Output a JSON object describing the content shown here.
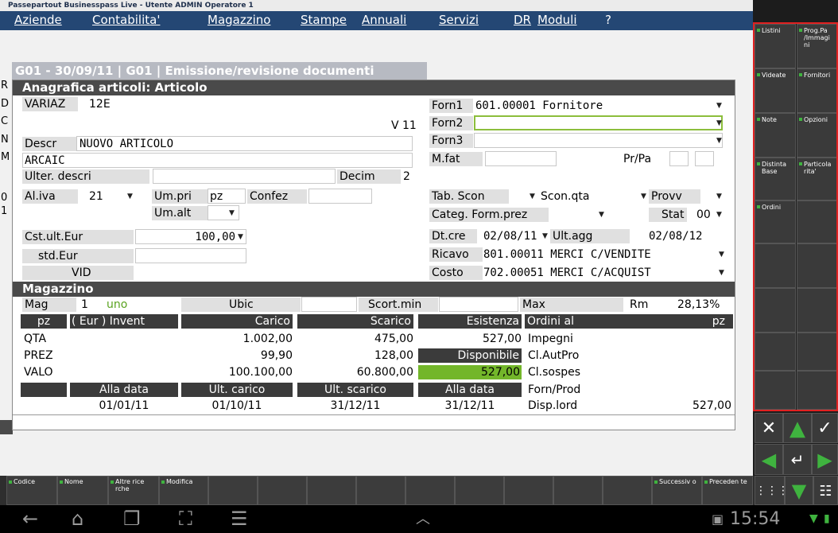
{
  "title": "Passepartout Businesspass Live - Utente ADMIN Operatore 1",
  "menu": [
    "Aziende",
    "Contabilita'",
    "Magazzino",
    "Stampe",
    "Annuali",
    "Servizi",
    "DR",
    "Moduli",
    "?"
  ],
  "doc_title": "G01 - 30/09/11 | G01  | Emissione/revisione documenti",
  "left_chars": [
    "R",
    "D",
    "C",
    "N",
    "M",
    "0",
    "1"
  ],
  "dialog_title": "Anagrafica articoli: Articolo",
  "art": {
    "variaz": "VARIAZ",
    "code": "12E",
    "version": "V 11",
    "descr_label": "Descr",
    "descr": "NUOVO ARTICOLO",
    "descr2": "ARCAIC",
    "ulter_label": "Ulter. descri",
    "decim_label": "Decim",
    "decim": "2",
    "aliva_label": "Al.iva",
    "aliva": "21",
    "umpri_label": "Um.pri",
    "umpri": "pz",
    "confez_label": "Confez",
    "umalt_label": "Um.alt",
    "cst_label": "Cst.ult.Eur",
    "cst": "100,00",
    "std_label": "std.Eur",
    "vid": "VID"
  },
  "right": {
    "forn1_label": "Forn1",
    "forn1": "601.00001 Fornitore",
    "forn2_label": "Forn2",
    "forn3_label": "Forn3",
    "mfat_label": "M.fat",
    "prpa_label": "Pr/Pa",
    "tabscon_label": "Tab. Scon",
    "sconqta_label": "Scon.qta",
    "provv_label": "Provv",
    "categ_label": "Categ. Form.prez",
    "stat_label": "Stat",
    "stat": "00",
    "dtcre_label": "Dt.cre",
    "dtcre": "02/08/11",
    "ultagg_label": "Ult.agg",
    "ultagg": "02/08/12",
    "ricavo_label": "Ricavo",
    "ricavo": "801.00011 MERCI C/VENDITE",
    "costo_label": "Costo",
    "costo": "702.00051 MERCI C/ACQUIST"
  },
  "mag": {
    "section_title": "Magazzino",
    "mag_label": "Mag",
    "mag_num": "1",
    "mag_name": "uno",
    "ubic_label": "Ubic",
    "scortmin_label": "Scort.min",
    "max_label": "Max",
    "rm_label": "Rm",
    "rm": "28,13%",
    "unit": "pz",
    "eur_invent": "( Eur )  Invent",
    "headers": {
      "carico": "Carico",
      "scarico": "Scarico",
      "esistenza": "Esistenza",
      "ordini": "Ordini al",
      "pz": "pz"
    },
    "rows": [
      {
        "label": "QTA",
        "carico": "1.002,00",
        "scarico": "475,00",
        "esist": "527,00",
        "right": "Impegni"
      },
      {
        "label": "PREZ",
        "carico": "99,90",
        "scarico": "128,00",
        "esist": "Disponibile",
        "right": "Cl.AutPro"
      },
      {
        "label": "VALO",
        "carico": "100.100,00",
        "scarico": "60.800,00",
        "esist": "527,00",
        "right": "Cl.sospes"
      }
    ],
    "date_headers": {
      "alla1": "Alla data",
      "ultcarico": "Ult. carico",
      "ultscarico": "Ult. scarico",
      "alla2": "Alla data",
      "fornprod": "Forn/Prod"
    },
    "dates": {
      "d1": "01/01/11",
      "d2": "01/10/11",
      "d3": "31/12/11",
      "d4": "31/12/11"
    },
    "displord_label": "Disp.lord",
    "displord": "527,00",
    "highlight_color": "#73b62a"
  },
  "right_buttons": [
    [
      "Listini",
      "Prog.Pa /Immagi ni"
    ],
    [
      "Videate",
      "Fornitori"
    ],
    [
      "Note",
      "Opzioni"
    ],
    [
      "Distinta Base",
      "Particola rita'"
    ],
    [
      "Ordini",
      ""
    ],
    [
      "",
      ""
    ],
    [
      "",
      ""
    ],
    [
      "",
      ""
    ],
    [
      "",
      ""
    ]
  ],
  "nav": {
    "close": "✕",
    "up": "▲",
    "ok": "✓",
    "left": "◀",
    "enter": "↵",
    "right": "▶",
    "grid": "⋮⋮⋮",
    "down": "▼",
    "grid2": "☷"
  },
  "fn_buttons": [
    "Codice",
    "Nome",
    "Altre rice rche",
    "Modifica",
    "",
    "",
    "",
    "",
    "",
    "",
    "",
    "",
    "",
    "",
    "Successiv o",
    "Preceden te"
  ],
  "clock": "15:54",
  "accent": "#3fb33f",
  "frame_color": "#e02020"
}
